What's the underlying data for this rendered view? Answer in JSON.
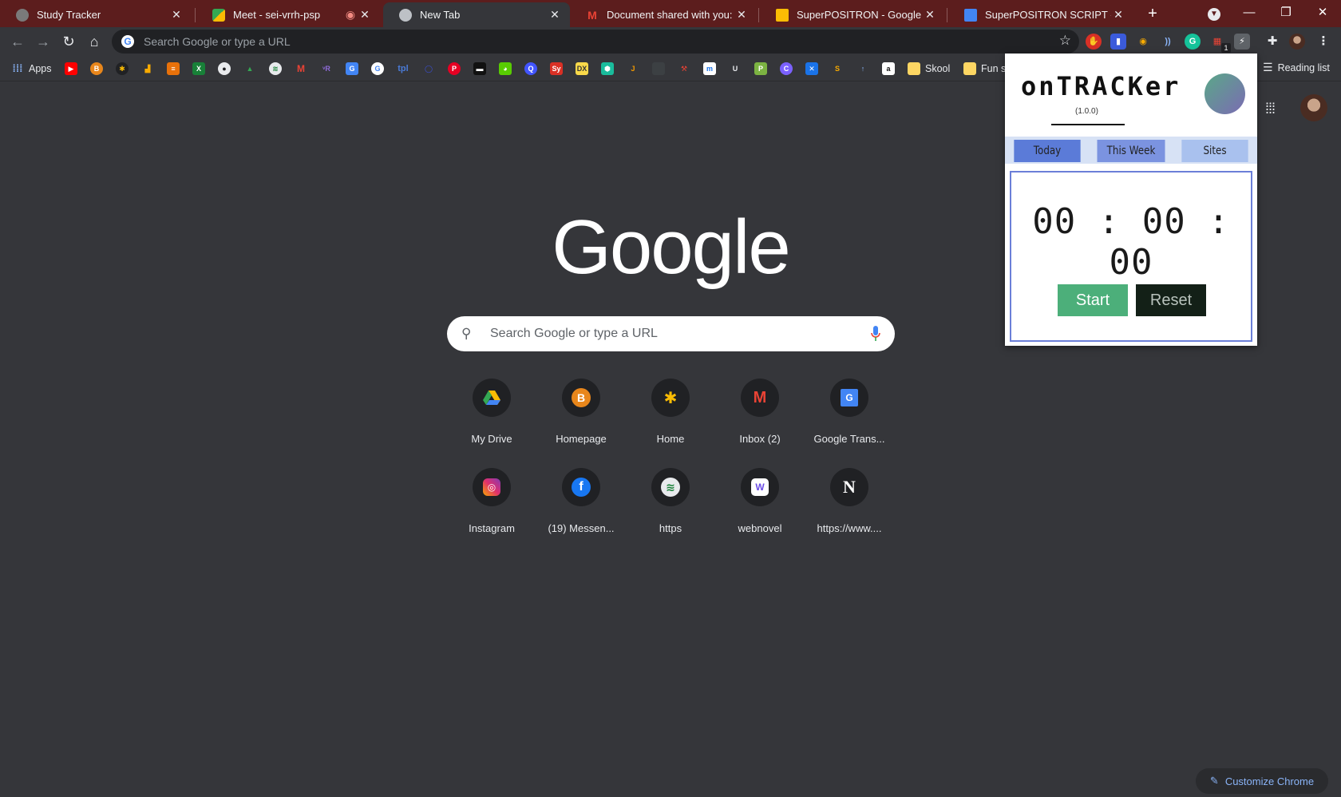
{
  "tabs": [
    {
      "title": "Study Tracker",
      "favicon": "globe-icon",
      "active": false
    },
    {
      "title": "Meet - sei-vrrh-psp",
      "favicon": "meet-icon",
      "active": false,
      "recording": true
    },
    {
      "title": "New Tab",
      "favicon": "chrome-icon",
      "active": true
    },
    {
      "title": "Document shared with you: \"Sup",
      "favicon": "gmail-icon",
      "active": false
    },
    {
      "title": "SuperPOSITRON - Google Slides",
      "favicon": "slides-icon",
      "active": false
    },
    {
      "title": "SuperPOSITRON SCRIPT - Goog",
      "favicon": "docs-icon",
      "active": false
    }
  ],
  "toolbar": {
    "omnibox_placeholder": "Search Google or type a URL",
    "extension_badge": "1"
  },
  "bookmarks": {
    "apps_label": "Apps",
    "skool_label": "Skool",
    "fun_label": "Fun s",
    "reading_list_label": "Reading list"
  },
  "page": {
    "logo_text": "Google",
    "search_placeholder": "Search Google or type a URL",
    "shortcuts": [
      {
        "label": "My Drive",
        "icon": "drive-icon"
      },
      {
        "label": "Homepage",
        "icon": "b-coin-icon"
      },
      {
        "label": "Home",
        "icon": "asterisk-icon"
      },
      {
        "label": "Inbox (2)",
        "icon": "gmail-icon"
      },
      {
        "label": "Google Trans...",
        "icon": "translate-icon"
      },
      {
        "label": "Instagram",
        "icon": "instagram-icon"
      },
      {
        "label": "(19) Messen...",
        "icon": "facebook-icon"
      },
      {
        "label": "https",
        "icon": "sphere-icon"
      },
      {
        "label": "webnovel",
        "icon": "webnovel-icon"
      },
      {
        "label": "https://www....",
        "icon": "n-icon"
      }
    ],
    "customize_label": "Customize Chrome"
  },
  "popup": {
    "title": "onTRACKer",
    "version": "(1.0.0)",
    "tabs": [
      "Today",
      "This Week",
      "Sites"
    ],
    "timer": "00 : 00 : 00",
    "start_label": "Start",
    "reset_label": "Reset",
    "colors": {
      "accent": "#6b7fd8",
      "start": "#4caf7a",
      "reset": "#132017"
    }
  }
}
